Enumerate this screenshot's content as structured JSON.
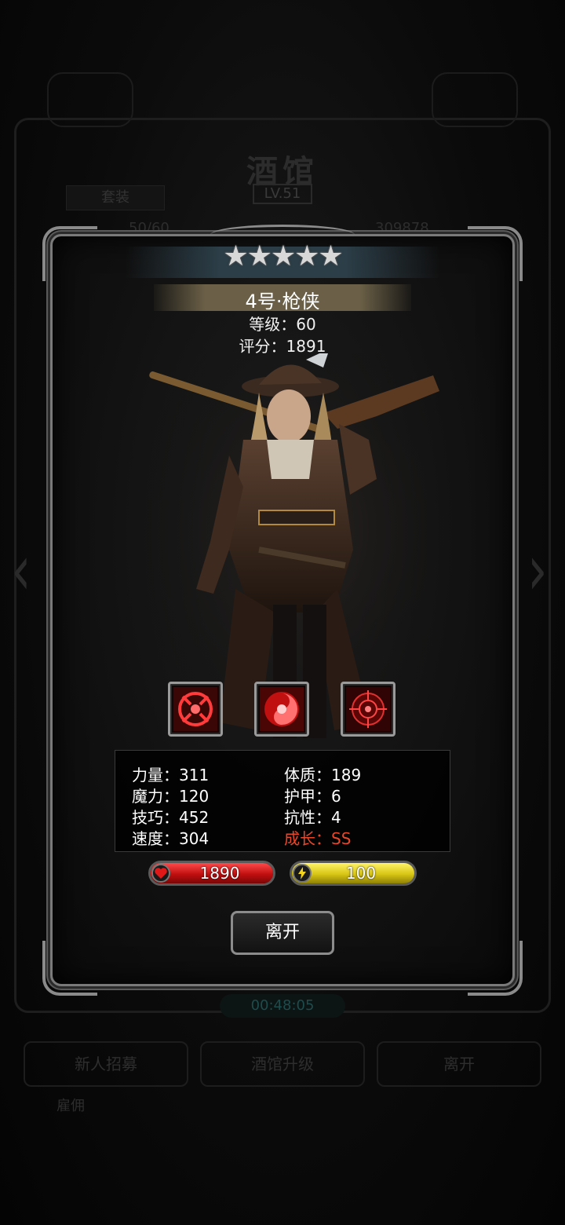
{
  "background": {
    "title": "酒馆",
    "level": "LV.51",
    "tag": "套装",
    "count": "50/60",
    "gold": "309878",
    "timer": "00:48:05",
    "buttons": [
      "新人招募",
      "酒馆升级",
      "离开"
    ],
    "footer_label": "雇佣",
    "nav_left": "‹",
    "nav_right": "›"
  },
  "hero": {
    "stars": "★★★★★",
    "star_count": 5,
    "name": "4号·枪侠",
    "level_line": "等级：60",
    "score_line": "评分：1891",
    "skills": [
      {
        "icon": "crosshair-burst-icon"
      },
      {
        "icon": "red-swirl-icon"
      },
      {
        "icon": "target-scope-icon"
      }
    ]
  },
  "stats": {
    "strength": "力量：311",
    "magic": "魔力：120",
    "skill": "技巧：452",
    "speed": "速度：304",
    "constitution": "体质：189",
    "armor": "护甲：6",
    "resistance": "抗性：4",
    "growth": "成长：SS"
  },
  "bars": {
    "hp": {
      "value": "1890",
      "fill": 1.0,
      "icon": "heart-icon"
    },
    "energy": {
      "value": "100",
      "fill": 1.0,
      "icon": "lightning-icon"
    }
  },
  "actions": {
    "leave": "离开"
  },
  "colors": {
    "growth": "#e8472a",
    "hp": "#c10f0f",
    "energy": "#d8c514",
    "frame": "#7a7a7a"
  }
}
